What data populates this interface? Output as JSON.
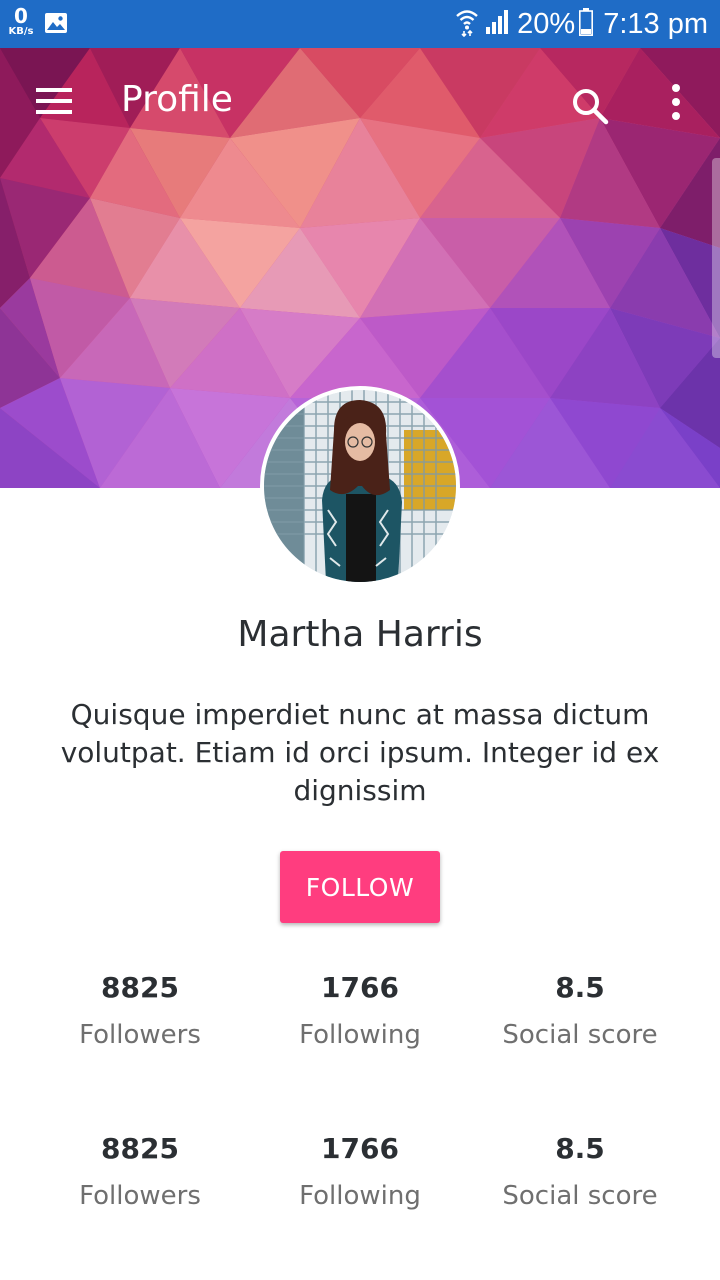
{
  "status_bar": {
    "net_speed_value": "0",
    "net_speed_unit": "KB/s",
    "battery": "20%",
    "time": "7:13 pm"
  },
  "toolbar": {
    "title": "Profile",
    "menu_icon": "hamburger-menu-icon",
    "search_icon": "search-icon",
    "more_icon": "more-vertical-icon"
  },
  "profile": {
    "name": "Martha Harris",
    "bio": "Quisque imperdiet nunc at massa dictum volutpat. Etiam id orci ipsum. Integer id ex dignissim",
    "follow_label": "FOLLOW"
  },
  "stats_rows": [
    [
      {
        "value": "8825",
        "label": "Followers"
      },
      {
        "value": "1766",
        "label": "Following"
      },
      {
        "value": "8.5",
        "label": "Social score"
      }
    ],
    [
      {
        "value": "8825",
        "label": "Followers"
      },
      {
        "value": "1766",
        "label": "Following"
      },
      {
        "value": "8.5",
        "label": "Social score"
      }
    ]
  ],
  "colors": {
    "status_bar": "#1f6cc6",
    "accent": "#ff3d7f",
    "text_primary": "#2b2f33",
    "text_secondary": "#6f6f6f"
  }
}
